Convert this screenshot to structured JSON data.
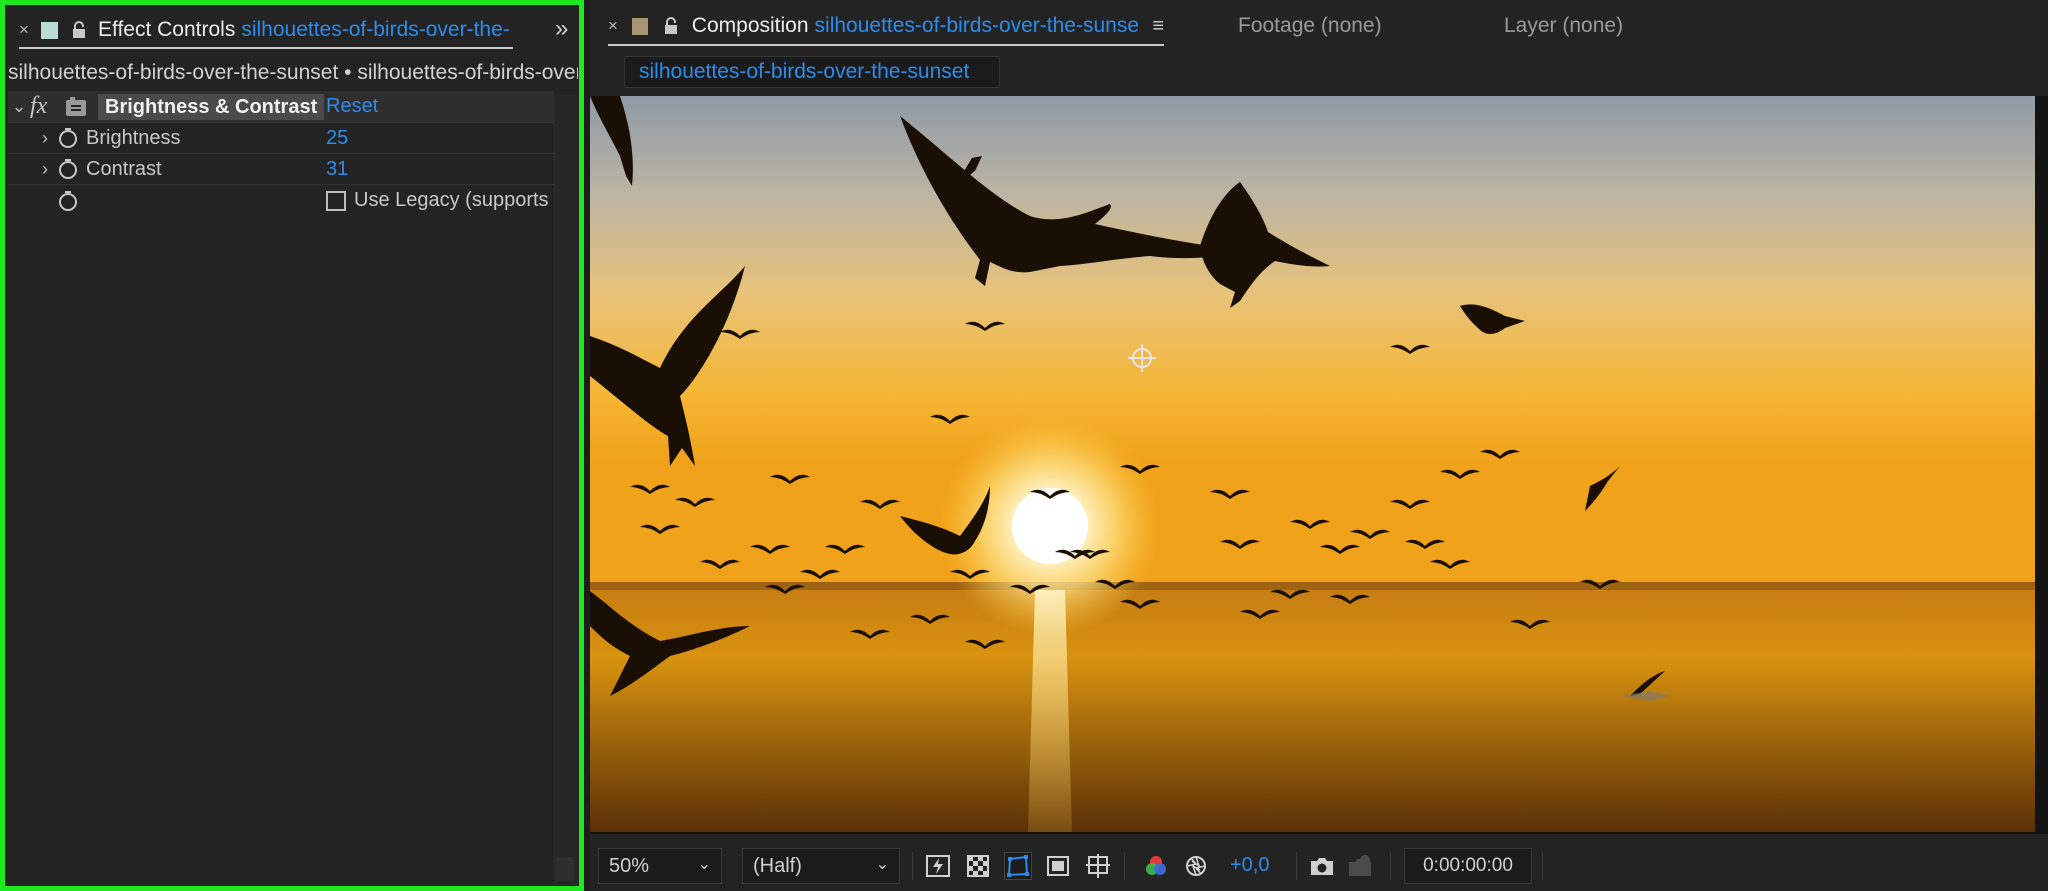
{
  "effect_controls": {
    "tab_title": "Effect Controls",
    "tab_comp_link": "silhouettes-of-birds-over-the-",
    "tab_close": "×",
    "overflow_glyph": "»",
    "breadcrumb": "silhouettes-of-birds-over-the-sunset • silhouettes-of-birds-over-t",
    "effect": {
      "fx_label": "fx",
      "name": "Brightness & Contrast",
      "reset_label": "Reset"
    },
    "properties": [
      {
        "name": "Brightness",
        "value": "25"
      },
      {
        "name": "Contrast",
        "value": "31"
      }
    ],
    "legacy_checkbox": {
      "label": "Use Legacy (supports",
      "checked": false
    },
    "swatch_color": "#b9dcd4",
    "highlight_color": "#1ee81e"
  },
  "composition": {
    "tab_title": "Composition",
    "tab_comp_link": "silhouettes-of-birds-over-the-sunset",
    "tab_close": "×",
    "menu_glyph": "≡",
    "footage_tab": "Footage (none)",
    "layer_tab": "Layer (none)",
    "subtab_label": "silhouettes-of-birds-over-the-sunset",
    "swatch_color": "#a89676"
  },
  "viewer_footer": {
    "zoom": "50%",
    "resolution": "(Half)",
    "exposure": "+0,0",
    "timecode": "0:00:00:00",
    "chevron": "⌄"
  },
  "accent_color": "#2d8ceb"
}
